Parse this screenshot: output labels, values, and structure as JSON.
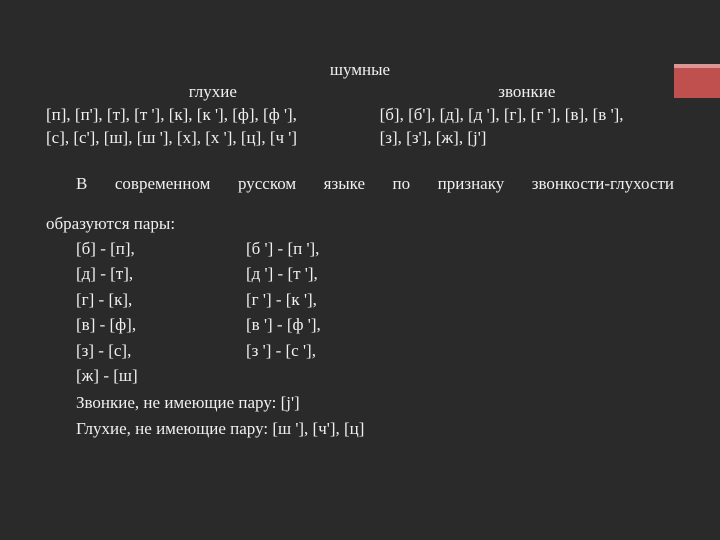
{
  "header": {
    "noisy": "шумные",
    "voiceless": "глухие",
    "voiced": "звонкие"
  },
  "voiceless_lines": [
    "[п], [п'], [т], [т '], [к], [к '], [ф], [ф '],",
    "[с], [с'], [ш], [ш '], [х], [х '], [ц], [ч ']"
  ],
  "voiced_lines": [
    "[б], [б'], [д], [д '], [г], [г '], [в], [в '],",
    "[з], [з'], [ж], [j']"
  ],
  "para": {
    "lead": "В современном русском языке по признаку звонкости-глухости",
    "tail": "образуются пары:"
  },
  "pairs": [
    {
      "a": "[б] - [п],",
      "b": "[б '] - [п '],"
    },
    {
      "a": "[д] - [т],",
      "b": "[д '] - [т '],"
    },
    {
      "a": "[г] - [к],",
      "b": "[г '] - [к '],"
    },
    {
      "a": "[в] - [ф],",
      "b": "[в '] - [ф '],"
    },
    {
      "a": "[з] - [с],",
      "b": "[з '] - [с '],"
    },
    {
      "a": "[ж] - [ш]",
      "b": ""
    }
  ],
  "trailing": [
    "Звонкие, не имеющие пару: [j']",
    "Глухие, не имеющие пару: [ш '], [ч'], [ц]"
  ]
}
